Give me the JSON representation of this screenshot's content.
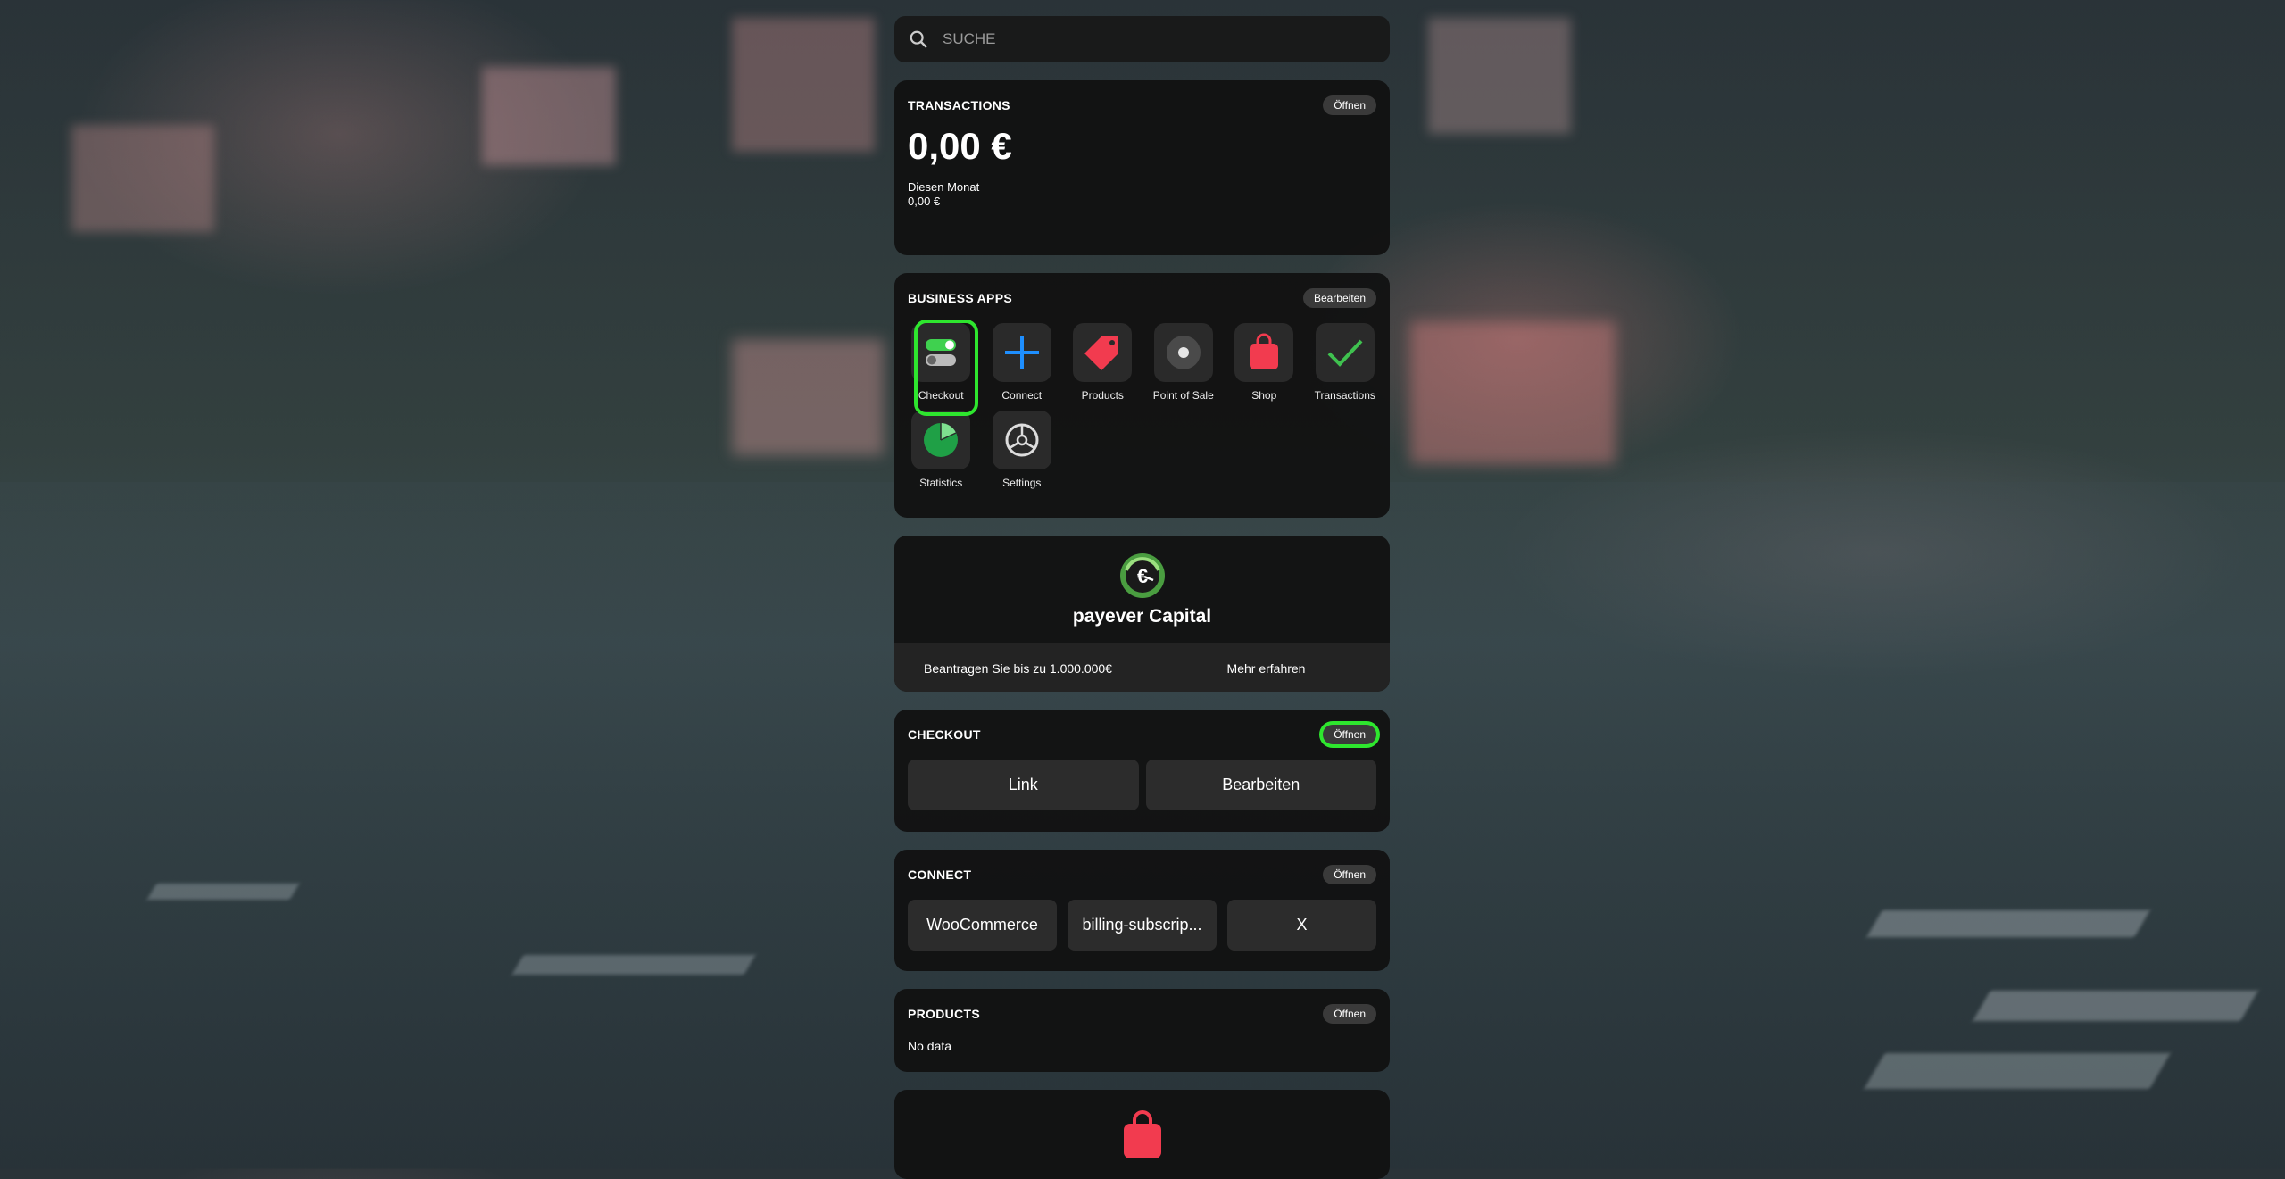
{
  "search": {
    "placeholder": "SUCHE",
    "icon": "search-icon"
  },
  "transactions_card": {
    "title": "TRANSACTIONS",
    "open_label": "Öffnen",
    "amount": "0,00 €",
    "period_label": "Diesen Monat",
    "period_amount": "0,00 €"
  },
  "business_apps": {
    "title": "BUSINESS APPS",
    "edit_label": "Bearbeiten",
    "apps": [
      {
        "label": "Checkout",
        "icon": "toggle-icon",
        "selected": true
      },
      {
        "label": "Connect",
        "icon": "plus-icon"
      },
      {
        "label": "Products",
        "icon": "tag-icon"
      },
      {
        "label": "Point of Sale",
        "icon": "pos-icon"
      },
      {
        "label": "Shop",
        "icon": "shopping-bag-icon"
      },
      {
        "label": "Transactions",
        "icon": "checkmark-icon"
      },
      {
        "label": "Statistics",
        "icon": "pie-chart-icon"
      },
      {
        "label": "Settings",
        "icon": "settings-icon"
      }
    ]
  },
  "capital": {
    "name": "payever Capital",
    "apply_label": "Beantragen Sie bis zu 1.000.000€",
    "learn_label": "Mehr erfahren"
  },
  "checkout_card": {
    "title": "CHECKOUT",
    "open_label": "Öffnen",
    "link_label": "Link",
    "edit_label": "Bearbeiten"
  },
  "connect_card": {
    "title": "CONNECT",
    "open_label": "Öffnen",
    "items": [
      "WooCommerce",
      "billing-subscrip...",
      "X"
    ]
  },
  "products_card": {
    "title": "PRODUCTS",
    "open_label": "Öffnen",
    "empty_text": "No data"
  },
  "colors": {
    "accent_green": "#2ee62e",
    "connect_blue": "#1e8fff",
    "shop_red": "#f23b4f",
    "card_bg": "#111111"
  }
}
